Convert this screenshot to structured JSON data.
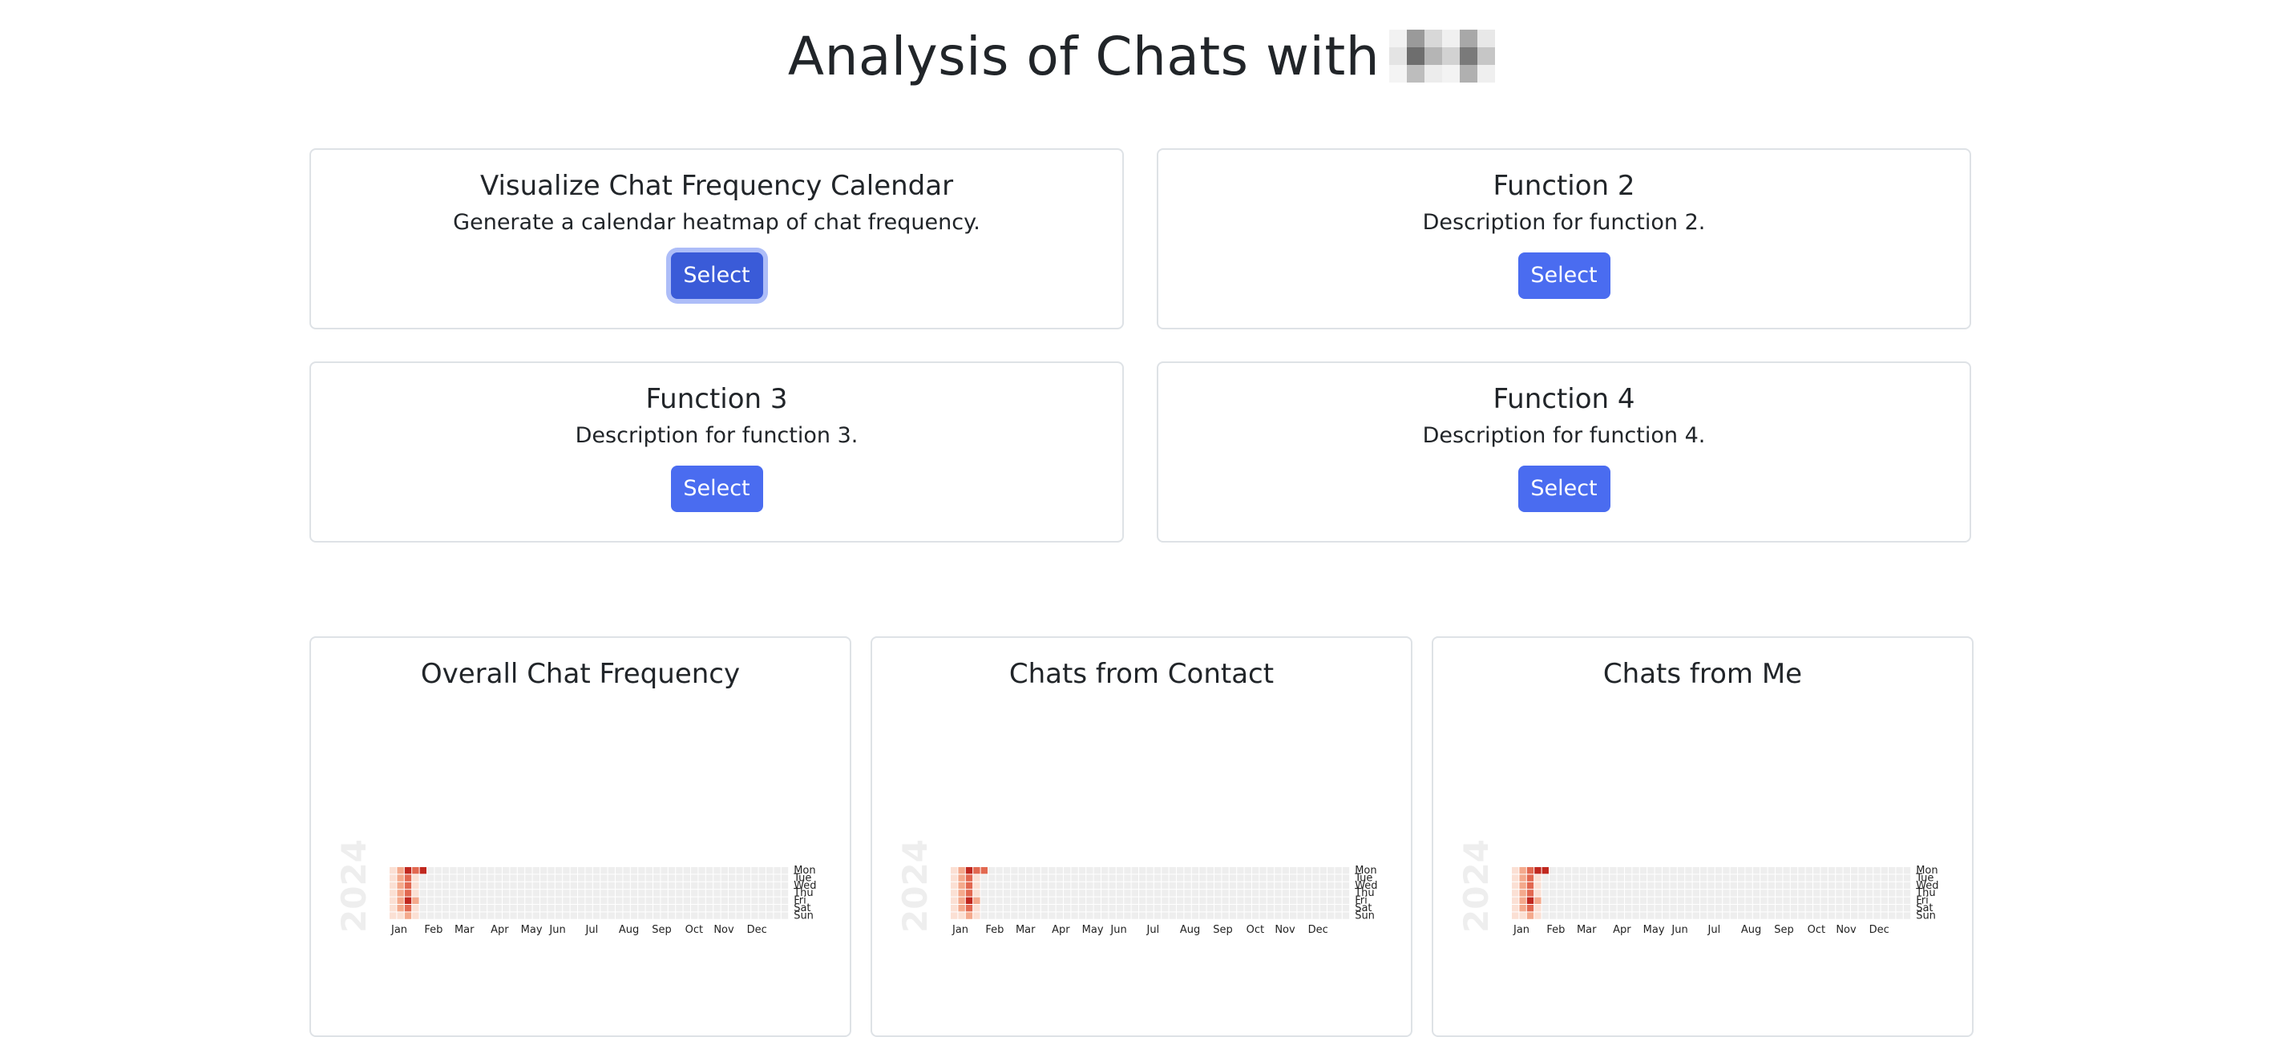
{
  "header": {
    "title": "Analysis of Chats with"
  },
  "functions": [
    {
      "title": "Visualize Chat Frequency Calendar",
      "description": "Generate a calendar heatmap of chat frequency.",
      "button": "Select",
      "focused": true
    },
    {
      "title": "Function 2",
      "description": "Description for function 2.",
      "button": "Select",
      "focused": false
    },
    {
      "title": "Function 3",
      "description": "Description for function 3.",
      "button": "Select",
      "focused": false
    },
    {
      "title": "Function 4",
      "description": "Description for function 4.",
      "button": "Select",
      "focused": false
    }
  ],
  "colors": {
    "button": "#4a6cf0",
    "button_focused": "#3a5bd8",
    "empty_cell": "#eeeeee",
    "heat_scale": [
      "#fbe0d4",
      "#f4a98c",
      "#e26850",
      "#c0281f",
      "#7d0a0a"
    ]
  },
  "chart_data": [
    {
      "type": "heatmap",
      "title": "Overall Chat Frequency",
      "year": "2024",
      "months": [
        "Jan",
        "Feb",
        "Mar",
        "Apr",
        "May",
        "Jun",
        "Jul",
        "Aug",
        "Sep",
        "Oct",
        "Nov",
        "Dec"
      ],
      "weekdays": [
        "Mon",
        "Tue",
        "Wed",
        "Thu",
        "Fri",
        "Sat",
        "Sun"
      ],
      "weeks": 53,
      "active_weeks": [
        [
          1,
          1,
          1,
          1,
          1,
          1,
          1
        ],
        [
          2,
          2,
          2,
          2,
          2,
          2,
          1
        ],
        [
          4,
          3,
          3,
          3,
          4,
          3,
          2
        ],
        [
          3,
          1,
          1,
          1,
          2,
          1,
          1
        ],
        [
          4,
          0,
          0,
          0,
          0,
          0,
          0
        ]
      ]
    },
    {
      "type": "heatmap",
      "title": "Chats from Contact",
      "year": "2024",
      "months": [
        "Jan",
        "Feb",
        "Mar",
        "Apr",
        "May",
        "Jun",
        "Jul",
        "Aug",
        "Sep",
        "Oct",
        "Nov",
        "Dec"
      ],
      "weekdays": [
        "Mon",
        "Tue",
        "Wed",
        "Thu",
        "Fri",
        "Sat",
        "Sun"
      ],
      "weeks": 53,
      "active_weeks": [
        [
          1,
          1,
          1,
          1,
          1,
          1,
          1
        ],
        [
          2,
          2,
          2,
          2,
          2,
          2,
          1
        ],
        [
          4,
          3,
          3,
          3,
          4,
          3,
          2
        ],
        [
          3,
          1,
          1,
          1,
          2,
          1,
          1
        ],
        [
          3,
          0,
          0,
          0,
          0,
          0,
          0
        ]
      ]
    },
    {
      "type": "heatmap",
      "title": "Chats from Me",
      "year": "2024",
      "months": [
        "Jan",
        "Feb",
        "Mar",
        "Apr",
        "May",
        "Jun",
        "Jul",
        "Aug",
        "Sep",
        "Oct",
        "Nov",
        "Dec"
      ],
      "weekdays": [
        "Mon",
        "Tue",
        "Wed",
        "Thu",
        "Fri",
        "Sat",
        "Sun"
      ],
      "weeks": 53,
      "active_weeks": [
        [
          1,
          1,
          1,
          1,
          1,
          1,
          1
        ],
        [
          2,
          2,
          2,
          2,
          2,
          2,
          1
        ],
        [
          3,
          3,
          3,
          3,
          4,
          3,
          2
        ],
        [
          4,
          1,
          1,
          1,
          2,
          1,
          1
        ],
        [
          4,
          0,
          0,
          0,
          0,
          0,
          0
        ]
      ]
    }
  ]
}
